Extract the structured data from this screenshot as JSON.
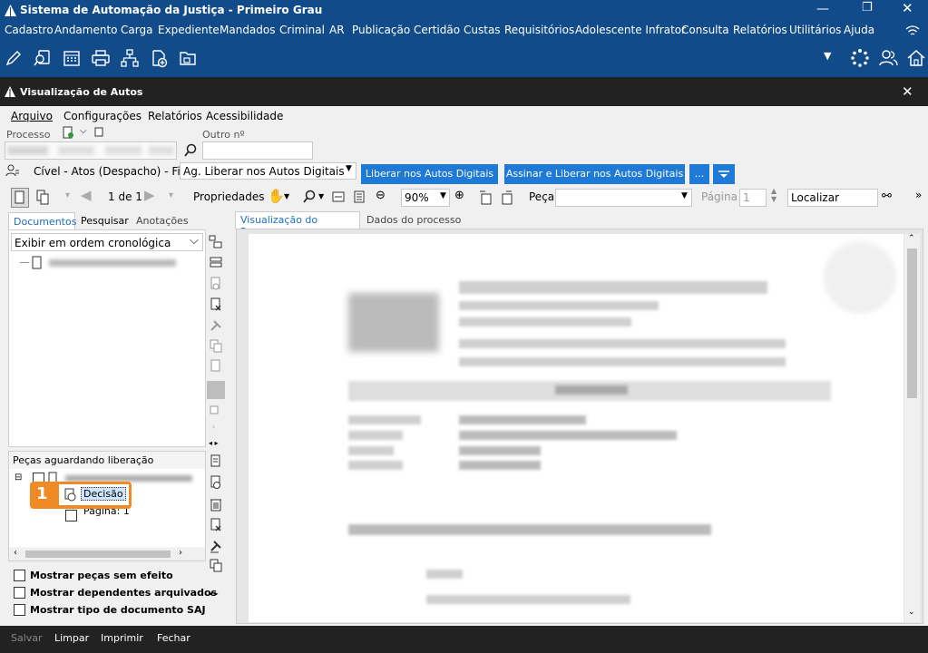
{
  "window": {
    "title": "Sistema de Automação da Justiça - Primeiro Grau"
  },
  "menu": [
    "Cadastro",
    "Andamento",
    "Carga",
    "Expediente",
    "Mandados",
    "Criminal",
    "AR",
    "Publicação",
    "Certidão",
    "Custas",
    "Requisitórios",
    "Adolescente Infrator",
    "Consulta",
    "Relatórios",
    "Utilitários",
    "Ajuda"
  ],
  "subwindow": {
    "title": "Visualização de Autos"
  },
  "submenu": [
    "Arquivo",
    "Configurações",
    "Relatórios",
    "Acessibilidade"
  ],
  "processo": {
    "label": "Processo",
    "outro_label": "Outro nº",
    "fila_text": "Cível - Atos (Despacho) - Fila:",
    "fila_value": "Ag. Liberar nos Autos Digitais",
    "liberar_btn": "Liberar nos Autos Digitais",
    "assinar_btn": "Assinar e Liberar nos Autos Digitais",
    "more_btn": "..."
  },
  "viewer_toolbar": {
    "page_indicator": "1 de 1",
    "propriedades": "Propriedades",
    "zoom": "90%",
    "peca_label": "Peça",
    "pagina_label": "Página",
    "pagina_value": "1",
    "localizar_value": "Localizar"
  },
  "left_tabs": [
    "Documentos",
    "Pesquisar",
    "Anotações"
  ],
  "order_select": "Exibir em ordem cronológica",
  "pieces_label": "Peças aguardando liberação",
  "tree": {
    "callout_number": "1",
    "decisao": "Decisão",
    "pagina": "Página: 1"
  },
  "options": [
    "Mostrar peças sem efeito",
    "Mostrar dependentes arquivados",
    "Mostrar tipo de documento SAJ"
  ],
  "right_tabs": [
    "Visualização do Processo",
    "Dados do processo"
  ],
  "bottom": [
    "Salvar",
    "Limpar",
    "Imprimir",
    "Fechar"
  ],
  "colors": {
    "titlebar": "#124b8a",
    "accent": "#1e7ad6",
    "callout": "#f08a24"
  }
}
